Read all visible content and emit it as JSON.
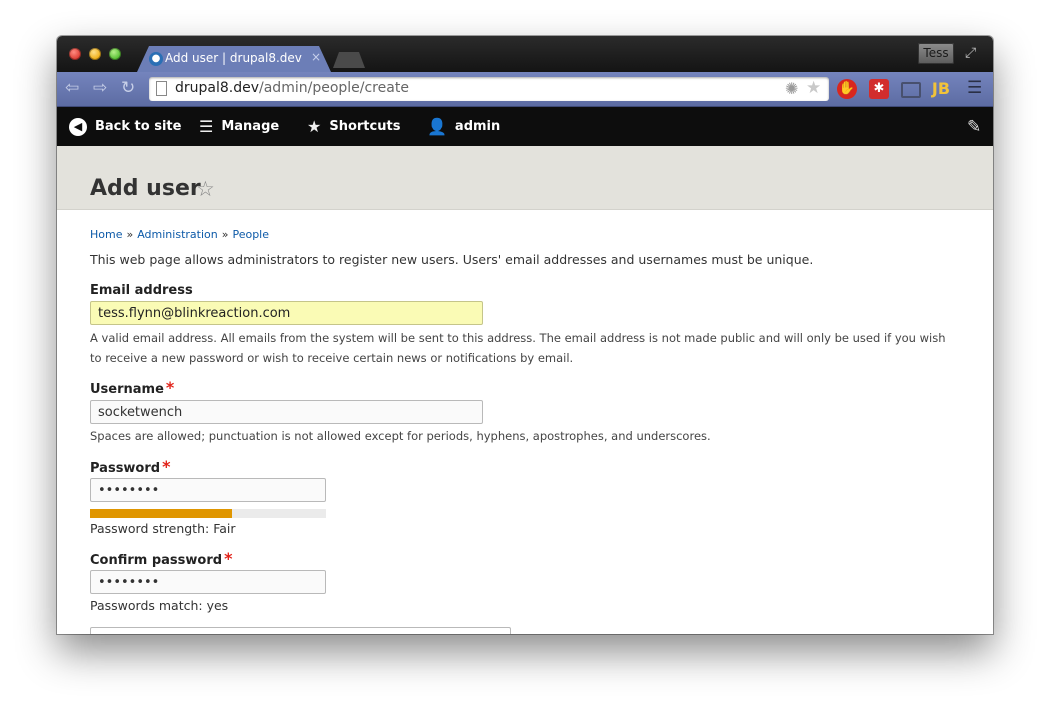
{
  "browser": {
    "tab_title": "Add user | drupal8.dev",
    "tab_close": "×",
    "profile_name": "Tess",
    "url_host": "drupal8.dev",
    "url_path": "/admin/people/create",
    "ext_adblock_glyph": "✋",
    "ext_lastpass_glyph": "✱",
    "ext_jb_glyph": "JB"
  },
  "admin_toolbar": {
    "back_to_site": "Back to site",
    "manage": "Manage",
    "shortcuts": "Shortcuts",
    "user": "admin"
  },
  "page": {
    "title": "Add user",
    "breadcrumb": [
      "Home",
      "Administration",
      "People"
    ],
    "breadcrumb_sep": "»",
    "intro": "This web page allows administrators to register new users. Users' email addresses and usernames must be unique."
  },
  "form": {
    "email": {
      "label": "Email address",
      "value": "tess.flynn@blinkreaction.com",
      "description": "A valid email address. All emails from the system will be sent to this address. The email address is not made public and will only be used if you wish to receive a new password or wish to receive certain news or notifications by email."
    },
    "username": {
      "label": "Username",
      "required_mark": "*",
      "value": "socketwench",
      "description": "Spaces are allowed; punctuation is not allowed except for periods, hyphens, apostrophes, and underscores."
    },
    "password": {
      "label": "Password",
      "required_mark": "*",
      "value": "••••••••",
      "strength_text": "Password strength: Fair",
      "strength_fraction": 0.6
    },
    "confirm_password": {
      "label": "Confirm password",
      "required_mark": "*",
      "value": "••••••••",
      "match_text": "Passwords match: yes"
    }
  },
  "colors": {
    "accent_link": "#0d5aa8",
    "required": "#e2231a",
    "strength_fair": "#e09600",
    "autofill_bg": "#fafbb5"
  }
}
